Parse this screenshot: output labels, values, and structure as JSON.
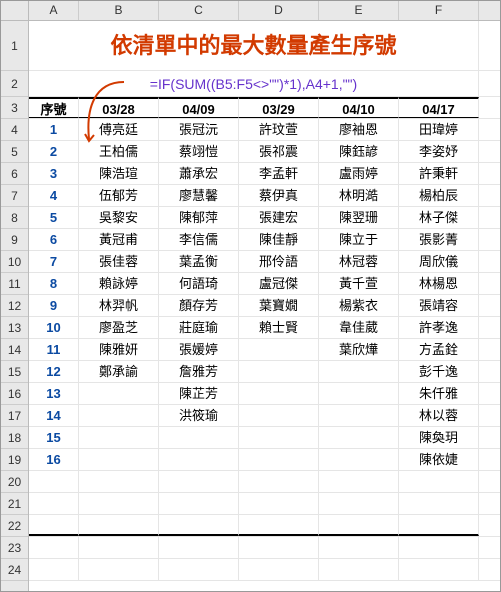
{
  "columns": [
    "A",
    "B",
    "C",
    "D",
    "E",
    "F"
  ],
  "row_numbers": [
    1,
    2,
    3,
    4,
    5,
    6,
    7,
    8,
    9,
    10,
    11,
    12,
    13,
    14,
    15,
    16,
    17,
    18,
    19,
    20,
    21,
    22,
    23,
    24
  ],
  "title": "依清單中的最大數量產生序號",
  "formula": "=IF(SUM((B5:F5<>\"\")*1),A4+1,\"\")",
  "headers": {
    "seq": "序號",
    "c1": "03/28",
    "c2": "04/09",
    "c3": "03/29",
    "c4": "04/10",
    "c5": "04/17"
  },
  "rows": [
    {
      "n": 1,
      "b": "傅亮廷",
      "c": "張冠沅",
      "d": "許玟萱",
      "e": "廖袖恩",
      "f": "田瑋婷"
    },
    {
      "n": 2,
      "b": "王柏儒",
      "c": "蔡翊愷",
      "d": "張祁震",
      "e": "陳鈺諺",
      "f": "李姿妤"
    },
    {
      "n": 3,
      "b": "陳浩瑄",
      "c": "蕭承宏",
      "d": "李孟軒",
      "e": "盧雨婷",
      "f": "許秉軒"
    },
    {
      "n": 4,
      "b": "伍郁芳",
      "c": "廖慧馨",
      "d": "蔡伊真",
      "e": "林明澔",
      "f": "楊柏辰"
    },
    {
      "n": 5,
      "b": "吳黎安",
      "c": "陳郁萍",
      "d": "張建宏",
      "e": "陳翌珊",
      "f": "林子傑"
    },
    {
      "n": 6,
      "b": "黃冠甫",
      "c": "李信儒",
      "d": "陳佳靜",
      "e": "陳立于",
      "f": "張影菁"
    },
    {
      "n": 7,
      "b": "張佳蓉",
      "c": "葉孟衡",
      "d": "邢伶語",
      "e": "林冠蓉",
      "f": "周欣儀"
    },
    {
      "n": 8,
      "b": "賴詠婷",
      "c": "何語琦",
      "d": "盧冠傑",
      "e": "黃千萱",
      "f": "林楊恩"
    },
    {
      "n": 9,
      "b": "林羿帆",
      "c": "顏存芳",
      "d": "葉寶嫺",
      "e": "楊紫衣",
      "f": "張靖容"
    },
    {
      "n": 10,
      "b": "廖盈芝",
      "c": "莊庭瑜",
      "d": "賴士賢",
      "e": "韋佳葳",
      "f": "許孝逸"
    },
    {
      "n": 11,
      "b": "陳雅妍",
      "c": "張媛婷",
      "d": "",
      "e": "葉欣燁",
      "f": "方孟銓"
    },
    {
      "n": 12,
      "b": "鄭承諭",
      "c": "詹雅芳",
      "d": "",
      "e": "",
      "f": "彭千逸"
    },
    {
      "n": 13,
      "b": "",
      "c": "陳芷芳",
      "d": "",
      "e": "",
      "f": "朱仟雅"
    },
    {
      "n": 14,
      "b": "",
      "c": "洪筱瑜",
      "d": "",
      "e": "",
      "f": "林以蓉"
    },
    {
      "n": 15,
      "b": "",
      "c": "",
      "d": "",
      "e": "",
      "f": "陳奐玥"
    },
    {
      "n": 16,
      "b": "",
      "c": "",
      "d": "",
      "e": "",
      "f": "陳依婕"
    }
  ]
}
